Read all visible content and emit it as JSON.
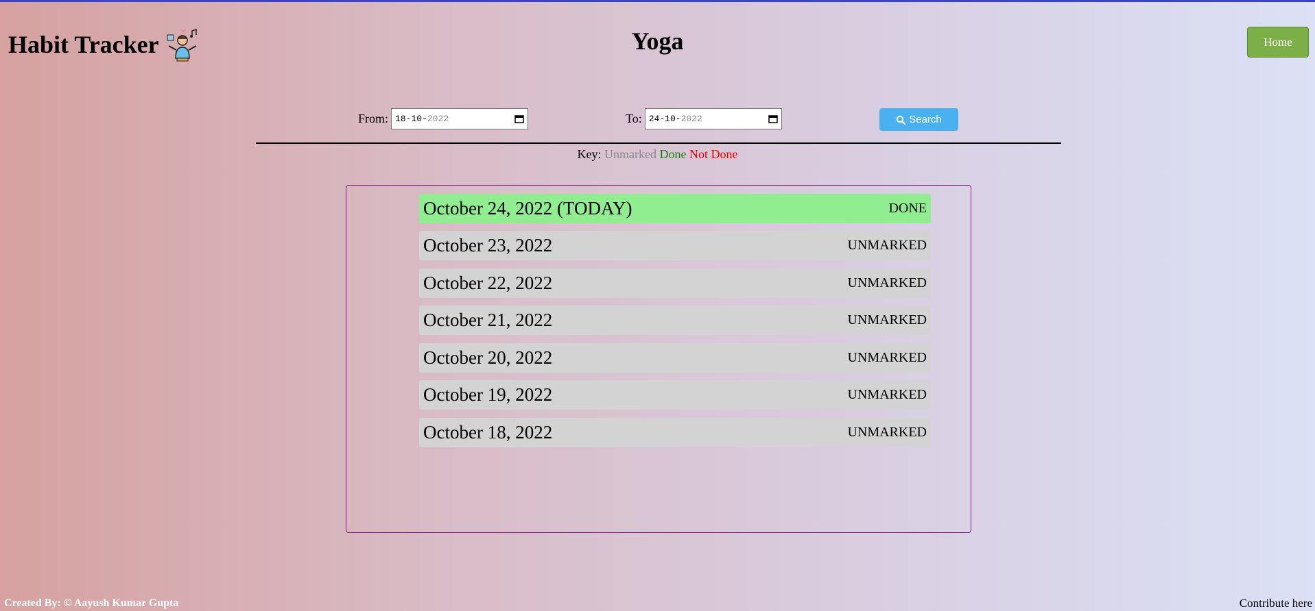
{
  "header": {
    "app_title": "Habit Tracker",
    "habit_name": "Yoga",
    "home_label": "Home"
  },
  "filter": {
    "from_label": "From:",
    "from_day": "18",
    "from_month": "10",
    "from_year": "2022",
    "to_label": "To:",
    "to_day": "24",
    "to_month": "10",
    "to_year": "2022",
    "search_label": "Search"
  },
  "key": {
    "label": "Key:",
    "unmarked": "Unmarked",
    "done": "Done",
    "not_done": "Not Done"
  },
  "days": [
    {
      "date": "October 24, 2022 (TODAY)",
      "status": "DONE"
    },
    {
      "date": "October 23, 2022",
      "status": "UNMARKED"
    },
    {
      "date": "October 22, 2022",
      "status": "UNMARKED"
    },
    {
      "date": "October 21, 2022",
      "status": "UNMARKED"
    },
    {
      "date": "October 20, 2022",
      "status": "UNMARKED"
    },
    {
      "date": "October 19, 2022",
      "status": "UNMARKED"
    },
    {
      "date": "October 18, 2022",
      "status": "UNMARKED"
    }
  ],
  "colors": {
    "done": "#90ee90",
    "unmarked": "#d3d3d3",
    "home_button": "#7caf48",
    "search_button": "#4ab1f0",
    "list_border": "#8a1a8a"
  },
  "footer": {
    "credit": "Created By: © Aayush Kumar Gupta",
    "contribute": "Contribute here"
  }
}
